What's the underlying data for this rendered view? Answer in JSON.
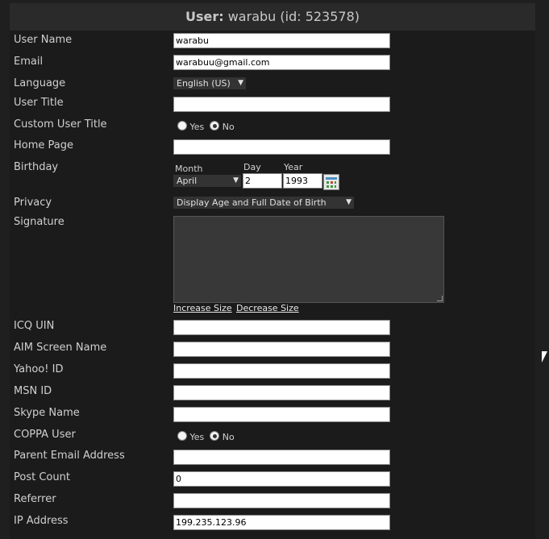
{
  "header": {
    "prefix": "User:",
    "rest": "warabu (id: 523578)"
  },
  "fields": {
    "user_name": {
      "label": "User Name",
      "value": "warabu"
    },
    "email": {
      "label": "Email",
      "value": "warabuu@gmail.com"
    },
    "language": {
      "label": "Language",
      "value": "English (US)"
    },
    "user_title": {
      "label": "User Title",
      "value": ""
    },
    "custom_user_title": {
      "label": "Custom User Title",
      "yes": "Yes",
      "no": "No",
      "selected": "No"
    },
    "home_page": {
      "label": "Home Page",
      "value": ""
    },
    "birthday": {
      "label": "Birthday",
      "month_label": "Month",
      "month_value": "April",
      "day_label": "Day",
      "day_value": "2",
      "year_label": "Year",
      "year_value": "1993"
    },
    "privacy": {
      "label": "Privacy",
      "value": "Display Age and Full Date of Birth"
    },
    "signature": {
      "label": "Signature",
      "increase": "Increase Size",
      "decrease": "Decrease Size"
    },
    "icq": {
      "label": "ICQ UIN",
      "value": ""
    },
    "aim": {
      "label": "AIM Screen Name",
      "value": ""
    },
    "yahoo": {
      "label": "Yahoo! ID",
      "value": ""
    },
    "msn": {
      "label": "MSN ID",
      "value": ""
    },
    "skype": {
      "label": "Skype Name",
      "value": ""
    },
    "coppa": {
      "label": "COPPA User",
      "yes": "Yes",
      "no": "No",
      "selected": "No"
    },
    "parent_email": {
      "label": "Parent Email Address",
      "value": ""
    },
    "post_count": {
      "label": "Post Count",
      "value": "0"
    },
    "referrer": {
      "label": "Referrer",
      "value": ""
    },
    "ip_address": {
      "label": "IP Address",
      "value": "199.235.123.96"
    }
  },
  "icons": {
    "calendar": "calendar-icon",
    "dropdown": "chevron-down-icon",
    "cursor": "mouse-pointer-icon"
  }
}
